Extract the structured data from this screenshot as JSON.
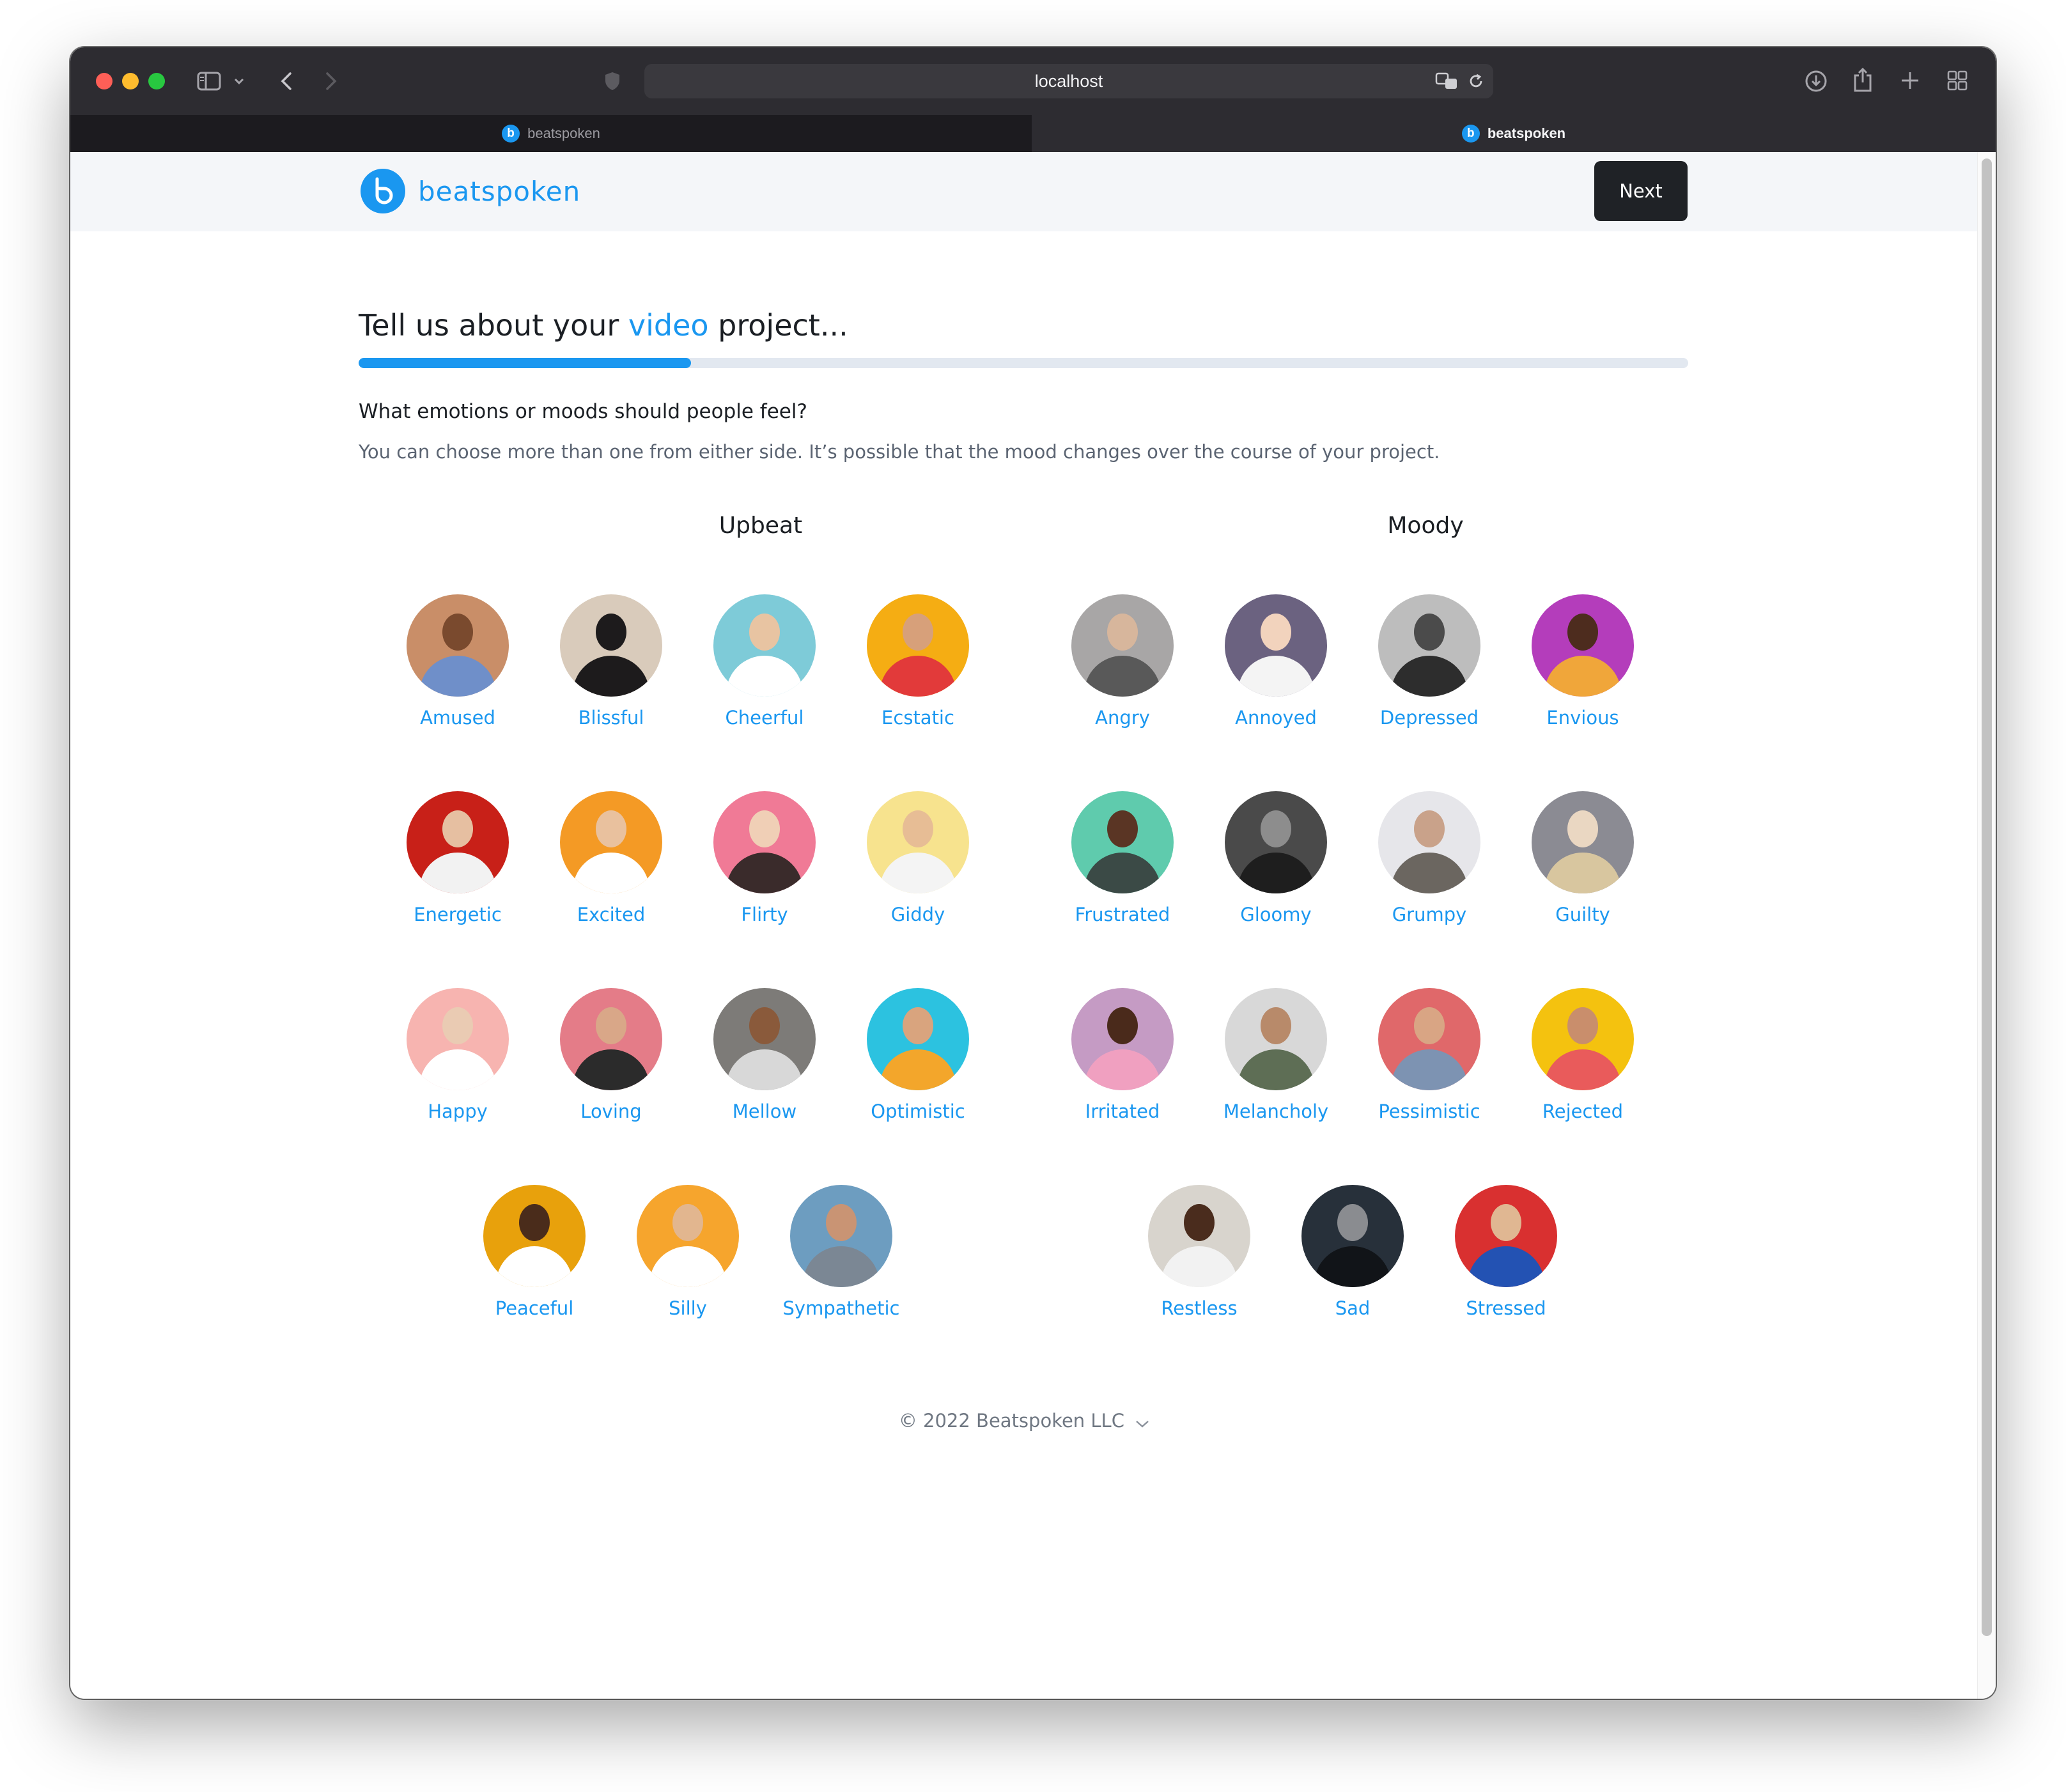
{
  "browser": {
    "url": "localhost",
    "tabs": [
      {
        "title": "beatspoken"
      },
      {
        "title": "beatspoken"
      }
    ]
  },
  "header": {
    "logo_text": "beatspoken",
    "next_label": "Next"
  },
  "page": {
    "heading_prefix": "Tell us about your ",
    "heading_accent": "video",
    "heading_suffix": " project...",
    "progress_fraction": 0.25,
    "question": "What emotions or moods should people feel?",
    "subtext": "You can choose more than one from either side. It’s possible that the mood changes over the course of your project."
  },
  "columns": [
    {
      "title": "Upbeat",
      "moods": [
        {
          "label": "Amused",
          "bg": "#c98e68",
          "skin": "#7a4a2e",
          "shirt": "#6f8fc9"
        },
        {
          "label": "Blissful",
          "bg": "#d9cbbb",
          "skin": "#1d1b1c",
          "shirt": "#1d1b1c"
        },
        {
          "label": "Cheerful",
          "bg": "#7ecbd8",
          "skin": "#e8c4a2",
          "shirt": "#ffffff"
        },
        {
          "label": "Ecstatic",
          "bg": "#f5ad13",
          "skin": "#d7a07a",
          "shirt": "#e23a3a"
        },
        {
          "label": "Energetic",
          "bg": "#c82018",
          "skin": "#e6bfa1",
          "shirt": "#f2f2f2"
        },
        {
          "label": "Excited",
          "bg": "#f49a25",
          "skin": "#e9c19e",
          "shirt": "#ffffff"
        },
        {
          "label": "Flirty",
          "bg": "#f07a96",
          "skin": "#f0cfb6",
          "shirt": "#3a2b2b"
        },
        {
          "label": "Giddy",
          "bg": "#f7e38e",
          "skin": "#e7bd95",
          "shirt": "#f4f4f4"
        },
        {
          "label": "Happy",
          "bg": "#f7b4b0",
          "skin": "#eacbb3",
          "shirt": "#ffffff"
        },
        {
          "label": "Loving",
          "bg": "#e47c88",
          "skin": "#d9a788",
          "shirt": "#2b2b2b"
        },
        {
          "label": "Mellow",
          "bg": "#7d7b78",
          "skin": "#8a5a3b",
          "shirt": "#d8d8d8"
        },
        {
          "label": "Optimistic",
          "bg": "#2cc2e0",
          "skin": "#d9a47e",
          "shirt": "#f3a62b"
        },
        {
          "label": "Peaceful",
          "bg": "#e8a10c",
          "skin": "#4a2c1b",
          "shirt": "#ffffff"
        },
        {
          "label": "Silly",
          "bg": "#f6a52d",
          "skin": "#e2b68f",
          "shirt": "#ffffff"
        },
        {
          "label": "Sympathetic",
          "bg": "#6d9dc0",
          "skin": "#c99474",
          "shirt": "#7b8794"
        }
      ]
    },
    {
      "title": "Moody",
      "moods": [
        {
          "label": "Angry",
          "bg": "#a8a6a6",
          "skin": "#d7b69c",
          "shirt": "#595959"
        },
        {
          "label": "Annoyed",
          "bg": "#6b6280",
          "skin": "#f2d3bd",
          "shirt": "#f4f4f4"
        },
        {
          "label": "Depressed",
          "bg": "#bdbdbd",
          "skin": "#4b4b4b",
          "shirt": "#2d2d2d"
        },
        {
          "label": "Envious",
          "bg": "#b43dbb",
          "skin": "#4d2c1e",
          "shirt": "#f0a63a"
        },
        {
          "label": "Frustrated",
          "bg": "#5fcbad",
          "skin": "#5a3524",
          "shirt": "#3b4a46"
        },
        {
          "label": "Gloomy",
          "bg": "#4a4a4a",
          "skin": "#8d8d8d",
          "shirt": "#1e1e1e"
        },
        {
          "label": "Grumpy",
          "bg": "#e6e6ea",
          "skin": "#c9a28a",
          "shirt": "#6b6660"
        },
        {
          "label": "Guilty",
          "bg": "#8b8b93",
          "skin": "#ead7c2",
          "shirt": "#d8c69f"
        },
        {
          "label": "Irritated",
          "bg": "#c59bc4",
          "skin": "#4a2a1b",
          "shirt": "#f0a0c0"
        },
        {
          "label": "Melancholy",
          "bg": "#d8d8d8",
          "skin": "#b88a6a",
          "shirt": "#5e6e55"
        },
        {
          "label": "Pessimistic",
          "bg": "#e0686a",
          "skin": "#d9a584",
          "shirt": "#7d93b2"
        },
        {
          "label": "Rejected",
          "bg": "#f4c20f",
          "skin": "#c98e6c",
          "shirt": "#e95b5b"
        },
        {
          "label": "Restless",
          "bg": "#d8d4cd",
          "skin": "#4a2c1d",
          "shirt": "#f2f2f2"
        },
        {
          "label": "Sad",
          "bg": "#27303a",
          "skin": "#8a8c90",
          "shirt": "#111418"
        },
        {
          "label": "Stressed",
          "bg": "#d93030",
          "skin": "#e0b792",
          "shirt": "#2352b3"
        }
      ]
    }
  ],
  "footer": {
    "copyright": "© 2022 Beatspoken LLC"
  },
  "colors": {
    "accent": "#1a97f0",
    "button_dark": "#1f2226",
    "header_bg": "#f4f6f9"
  }
}
